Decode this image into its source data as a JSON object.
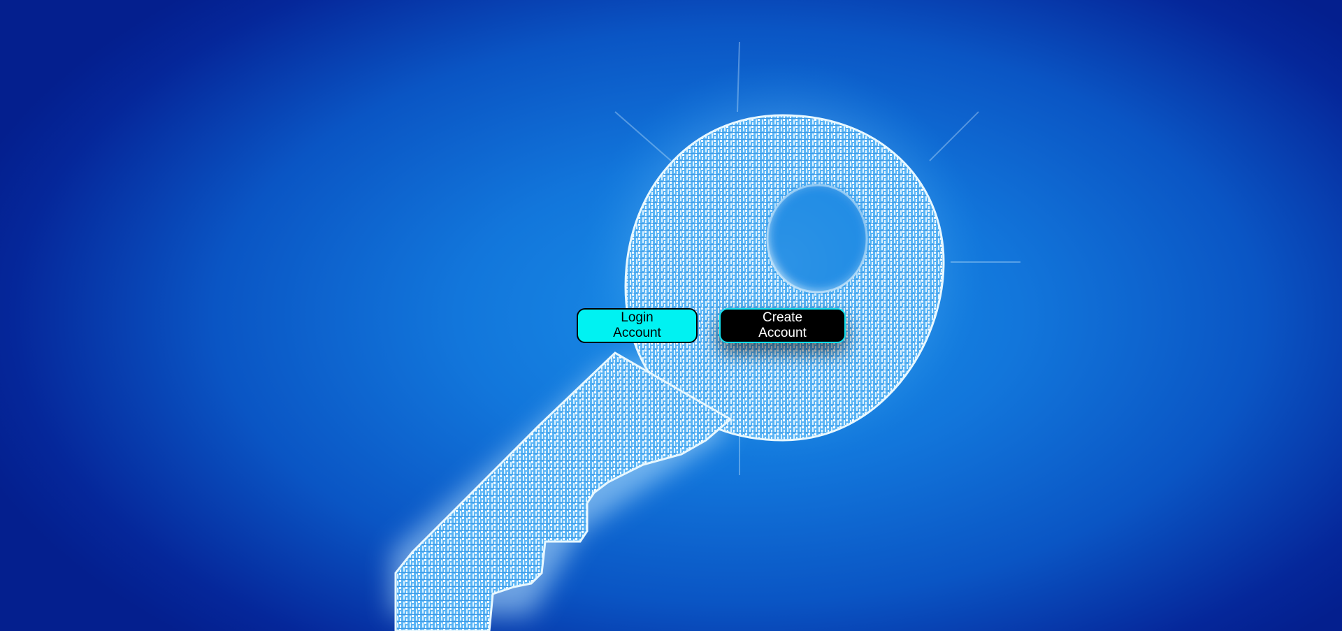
{
  "background": {
    "image": "key-made-of-binary-code",
    "colors": {
      "deep_blue": "#041f8e",
      "mid_blue": "#1276db",
      "glow": "#bfe6ff"
    }
  },
  "actions": {
    "login_label": "Login Account",
    "create_label": "Create Account"
  },
  "colors": {
    "login_bg": "#00f2f2",
    "create_bg": "#000000",
    "create_border": "#10e0ee"
  }
}
